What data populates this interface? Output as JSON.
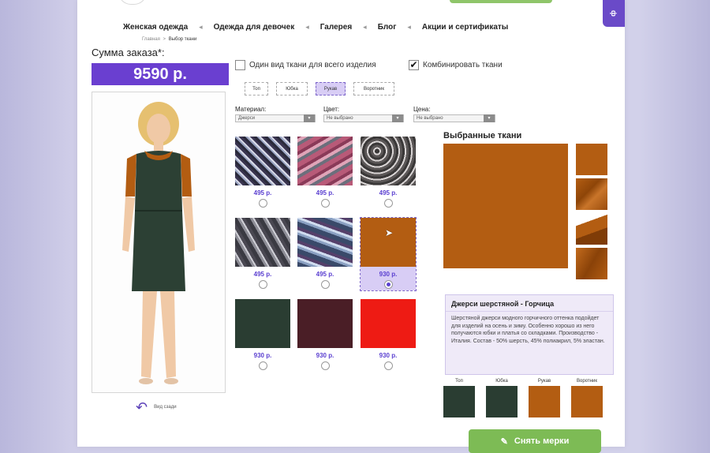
{
  "side_tab": "ф",
  "nav": {
    "items": [
      "Женская одежда",
      "Одежда для девочек",
      "Галерея",
      "Блог",
      "Акции и сертификаты"
    ],
    "arrow": "◂"
  },
  "breadcrumb": {
    "home": "Главная",
    "sep": ">",
    "current": "Выбор ткани"
  },
  "order": {
    "label": "Сумма заказа*:",
    "value": "9590 р."
  },
  "rotate": {
    "label": "Вид сзади"
  },
  "options": {
    "single": {
      "label": "Один вид ткани для всего изделия",
      "checked": false
    },
    "combine": {
      "label": "Комбинировать ткани",
      "checked": true
    }
  },
  "parts": [
    {
      "label": "Топ",
      "active": false
    },
    {
      "label": "Юбка",
      "active": false
    },
    {
      "label": "Рукав",
      "active": true
    },
    {
      "label": "Воротник",
      "active": false
    }
  ],
  "filters": {
    "material": {
      "label": "Материал:",
      "value": "Джерси"
    },
    "color": {
      "label": "Цвет:",
      "value": "Не выбрано"
    },
    "price": {
      "label": "Цена:",
      "value": "Не выбрано"
    }
  },
  "fabrics": [
    {
      "price": "495 р.",
      "swatch": "texture-blue-tweed",
      "selected": false
    },
    {
      "price": "495 р.",
      "swatch": "texture-pink-print",
      "selected": false
    },
    {
      "price": "495 р.",
      "swatch": "texture-bw-pattern",
      "selected": false
    },
    {
      "price": "495 р.",
      "swatch": "texture-grey-print",
      "selected": false
    },
    {
      "price": "495 р.",
      "swatch": "texture-blue-floral",
      "selected": false
    },
    {
      "price": "930 р.",
      "swatch": "#b35d12",
      "selected": true
    },
    {
      "price": "930 р.",
      "swatch": "#2a3d32",
      "selected": false
    },
    {
      "price": "930 р.",
      "swatch": "#4a1e26",
      "selected": false
    },
    {
      "price": "930 р.",
      "swatch": "#ee1b14",
      "selected": false
    }
  ],
  "selected": {
    "title": "Выбранные ткани",
    "big_color": "#b35d12",
    "desc_title": "Джерси шерстяной - Горчица",
    "desc_text": "Шерстяной джерси модного горчичного оттенка подойдет для изделий на осень и зиму. Особенно хорошо из него получаются юбки и платья со складками. Производство - Италия. Состав - 50% шерсть, 45% полиакрил, 5% эластан."
  },
  "mini_parts": [
    {
      "label": "Топ",
      "color": "#2a3d32"
    },
    {
      "label": "Юбка",
      "color": "#2a3d32"
    },
    {
      "label": "Рукав",
      "color": "#b35d12"
    },
    {
      "label": "Воротник",
      "color": "#b35d12"
    }
  ],
  "measure_button": {
    "label": "Снять мерки"
  },
  "colors": {
    "accent": "#6a3fd0",
    "green": "#7dbb55"
  }
}
